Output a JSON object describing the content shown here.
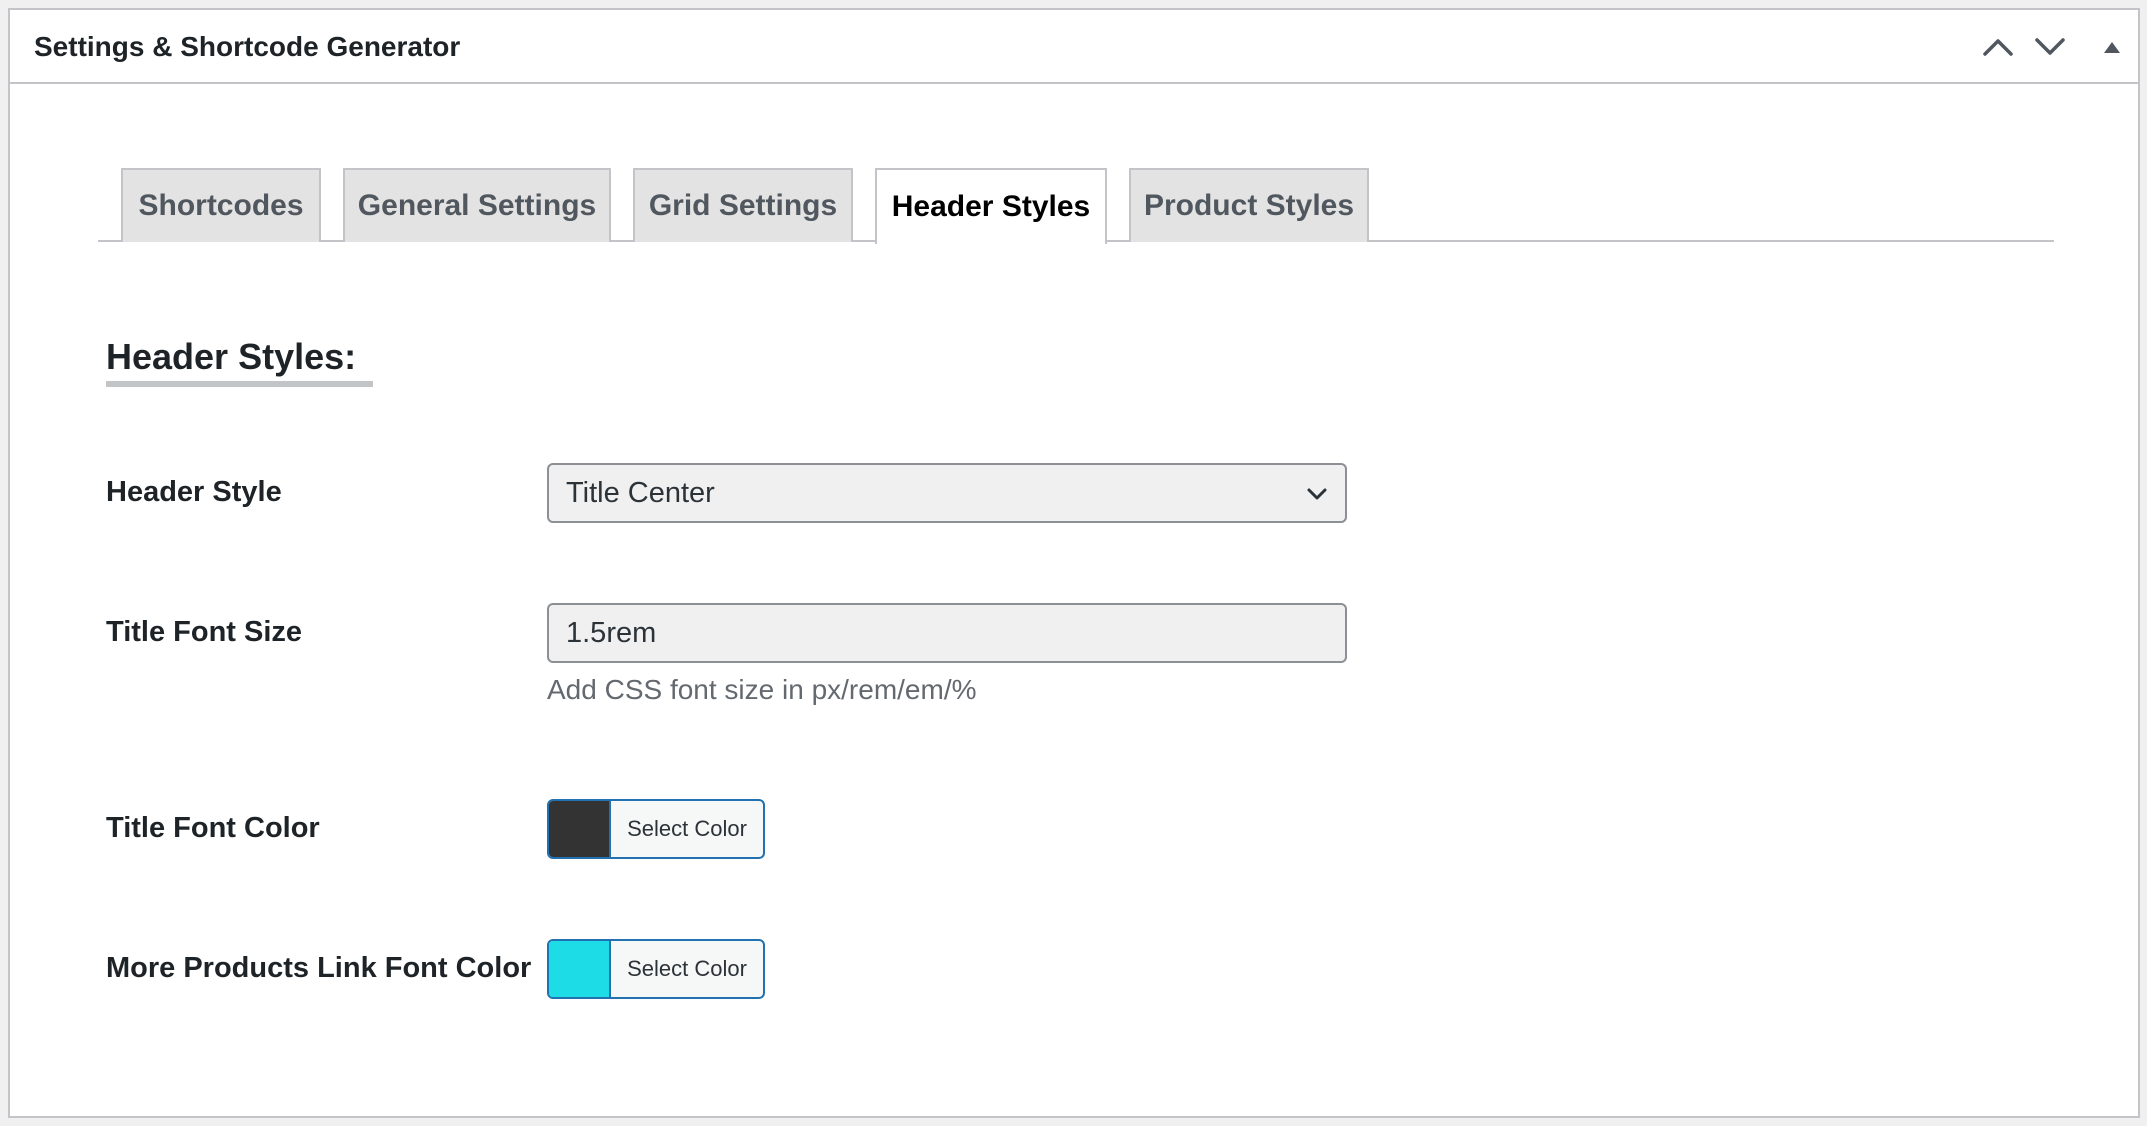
{
  "panel": {
    "title": "Settings & Shortcode Generator",
    "controls": [
      "chevron-up-icon",
      "chevron-down-icon",
      "triangle-up-icon"
    ]
  },
  "tabs": [
    {
      "label": "Shortcodes",
      "active": false
    },
    {
      "label": "General Settings",
      "active": false
    },
    {
      "label": "Grid Settings",
      "active": false
    },
    {
      "label": "Header Styles",
      "active": true
    },
    {
      "label": "Product Styles",
      "active": false
    }
  ],
  "section": {
    "title": "Header Styles:"
  },
  "fields": {
    "header_style": {
      "label": "Header Style",
      "value": "Title Center"
    },
    "title_font_size": {
      "label": "Title Font Size",
      "value": "1.5rem",
      "help": "Add CSS font size in px/rem/em/%"
    },
    "title_font_color": {
      "label": "Title Font Color",
      "button_label": "Select Color",
      "color": "#333333"
    },
    "more_link_color": {
      "label": "More Products Link Font Color",
      "button_label": "Select Color",
      "color": "#1ddce6"
    }
  },
  "colors": {
    "accent": "#2271b1",
    "border": "#c3c4c7",
    "tab_inactive_bg": "#e3e3e3"
  }
}
